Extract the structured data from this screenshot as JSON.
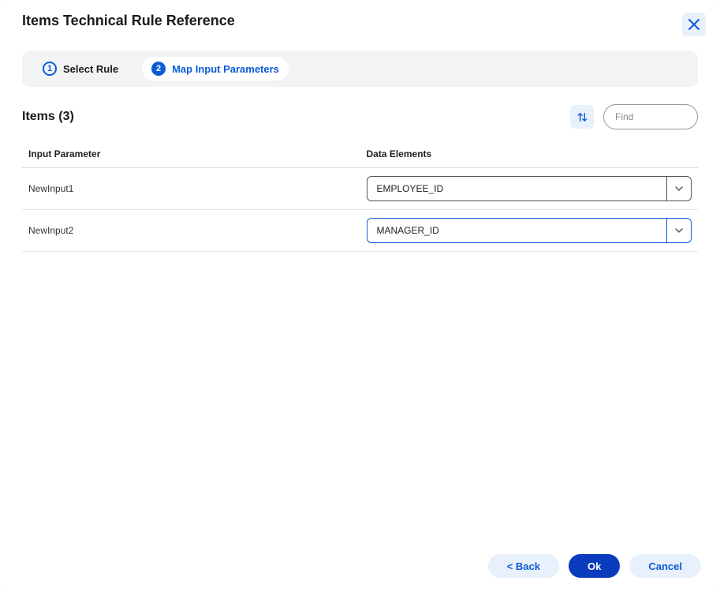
{
  "dialog": {
    "title": "Items Technical Rule Reference"
  },
  "steps": {
    "step1": {
      "number": "1",
      "label": "Select Rule"
    },
    "step2": {
      "number": "2",
      "label": "Map Input Parameters"
    }
  },
  "items": {
    "title": "Items (3)",
    "find_placeholder": "Find"
  },
  "table": {
    "headers": {
      "input_parameter": "Input Parameter",
      "data_elements": "Data Elements"
    },
    "rows": [
      {
        "input_parameter": "NewInput1",
        "data_element": "EMPLOYEE_ID"
      },
      {
        "input_parameter": "NewInput2",
        "data_element": "MANAGER_ID"
      }
    ]
  },
  "footer": {
    "back": "< Back",
    "ok": "Ok",
    "cancel": "Cancel"
  }
}
